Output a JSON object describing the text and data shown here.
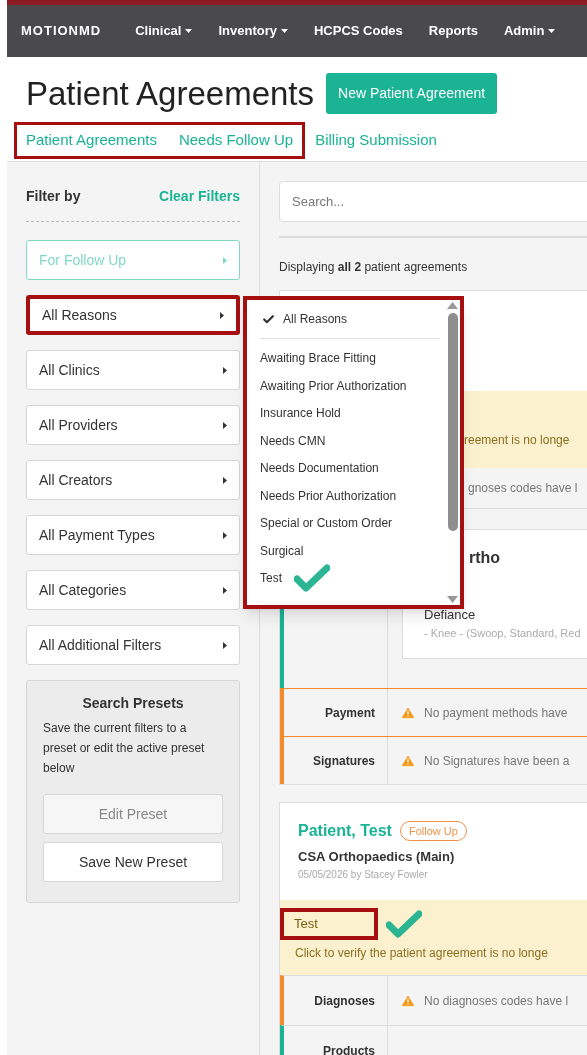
{
  "nav": {
    "brand": "MOTIONMD",
    "items": [
      {
        "label": "Clinical",
        "caret": true
      },
      {
        "label": "Inventory",
        "caret": true
      },
      {
        "label": "HCPCS Codes",
        "caret": false
      },
      {
        "label": "Reports",
        "caret": false
      },
      {
        "label": "Admin",
        "caret": true
      }
    ]
  },
  "page": {
    "title": "Patient Agreements",
    "new_button": "New Patient Agreement"
  },
  "tabs": [
    {
      "label": "Patient Agreements",
      "highlighted": true
    },
    {
      "label": "Needs Follow Up",
      "highlighted": true
    },
    {
      "label": "Billing Submission",
      "highlighted": false
    }
  ],
  "sidebar": {
    "title": "Filter by",
    "clear": "Clear Filters",
    "filters": [
      {
        "label": "For Follow Up",
        "active": true,
        "highlighted": false
      },
      {
        "label": "All Reasons",
        "active": false,
        "highlighted": true
      },
      {
        "label": "All Clinics",
        "active": false,
        "highlighted": false
      },
      {
        "label": "All Providers",
        "active": false,
        "highlighted": false
      },
      {
        "label": "All Creators",
        "active": false,
        "highlighted": false
      },
      {
        "label": "All Payment Types",
        "active": false,
        "highlighted": false
      },
      {
        "label": "All Categories",
        "active": false,
        "highlighted": false
      },
      {
        "label": "All Additional Filters",
        "active": false,
        "highlighted": false
      }
    ],
    "presets": {
      "title": "Search Presets",
      "description": "Save the current filters to a preset or edit the active preset below",
      "buttons": [
        {
          "label": "Edit Preset",
          "disabled": true
        },
        {
          "label": "Save New Preset",
          "disabled": false
        }
      ]
    }
  },
  "search": {
    "placeholder": "Search..."
  },
  "summary": "Displaying **all 2** patient agreements",
  "reasons_menu": {
    "all": {
      "label": "All Reasons",
      "selected": true
    },
    "items": [
      {
        "label": "Awaiting Brace Fitting",
        "selected": false,
        "ticked": false
      },
      {
        "label": "Awaiting Prior Authorization",
        "selected": false,
        "ticked": false
      },
      {
        "label": "Insurance Hold",
        "selected": false,
        "ticked": false
      },
      {
        "label": "Needs CMN",
        "selected": false,
        "ticked": false
      },
      {
        "label": "Needs Documentation",
        "selected": false,
        "ticked": false
      },
      {
        "label": "Needs Prior Authorization",
        "selected": false,
        "ticked": false
      },
      {
        "label": "Special or Custom Order",
        "selected": false,
        "ticked": false
      },
      {
        "label": "Surgical",
        "selected": false,
        "ticked": false
      },
      {
        "label": "Test",
        "selected": false,
        "ticked": true
      }
    ]
  },
  "card_1": {
    "alert_fragment": "reement is no longe",
    "diagnoses_fragment": "gnoses codes have l",
    "product_title": "rtho",
    "product_name": "Defiance",
    "product_detail": "- Knee - (Swoop, Standard, Red",
    "rows": [
      {
        "label": "Payment",
        "text": "No payment methods have"
      },
      {
        "label": "Signatures",
        "text": "No Signatures have been a"
      }
    ]
  },
  "card_2": {
    "name": "Patient, Test",
    "badge": "Follow Up",
    "clinic": "CSA Orthopaedics (Main)",
    "meta": "05/05/2026 by Stacey Fowler",
    "reason": "Test",
    "reason_highlighted": true,
    "reason_ticked": true,
    "alert": "Click to verify the patient agreement is no longe",
    "rows": [
      {
        "label": "Diagnoses",
        "text": "No diagnoses codes have l",
        "kind": "warning"
      },
      {
        "label": "Products",
        "kind": "plain"
      }
    ]
  }
}
